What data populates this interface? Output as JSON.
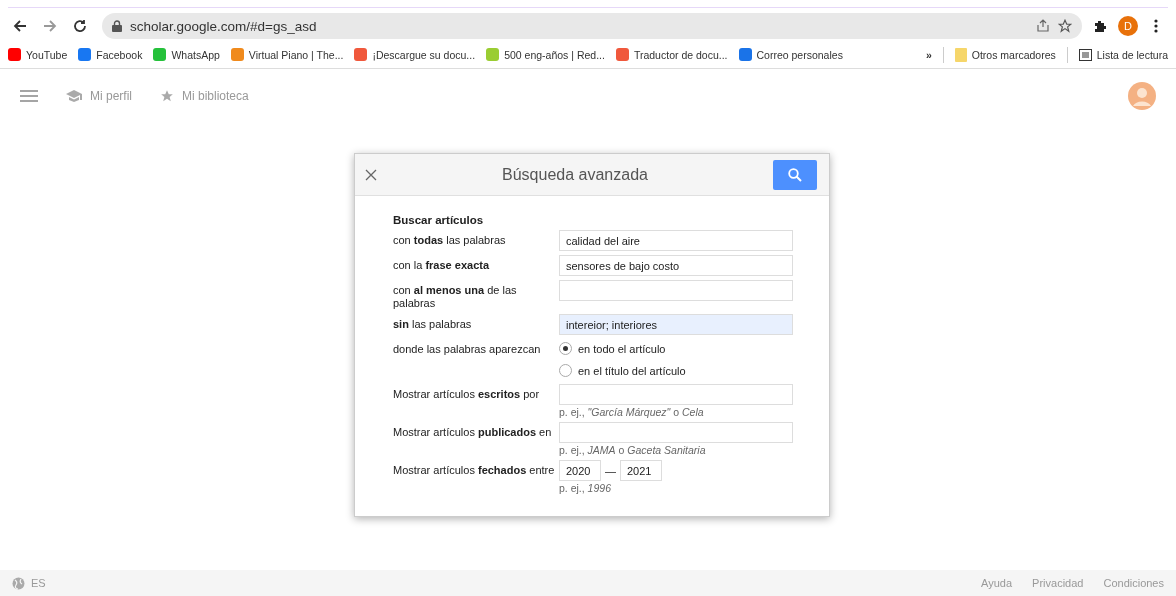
{
  "browser": {
    "url": "scholar.google.com/#d=gs_asd",
    "profile_initial": "D",
    "bookmarks": [
      {
        "label": "YouTube",
        "color": "#ff0000"
      },
      {
        "label": "Facebook",
        "color": "#1877f2"
      },
      {
        "label": "WhatsApp",
        "color": "#25c13b"
      },
      {
        "label": "Virtual Piano | The...",
        "color": "#f08a1c"
      },
      {
        "label": "¡Descargue su docu...",
        "color": "#f0583c"
      },
      {
        "label": "500 eng-años | Red...",
        "color": "#9acd32"
      },
      {
        "label": "Traductor de docu...",
        "color": "#f0583c"
      },
      {
        "label": "Correo personales",
        "color": "#1a73e8"
      }
    ],
    "more": "»",
    "other_bookmarks": "Otros marcadores",
    "reading_list": "Lista de lectura"
  },
  "header": {
    "nav": [
      {
        "label": "Mi perfil",
        "kind": "profile"
      },
      {
        "label": "Mi biblioteca",
        "kind": "library"
      }
    ]
  },
  "dialog": {
    "title": "Búsqueda avanzada",
    "section": "Buscar artículos",
    "rows": [
      {
        "kind": "text",
        "label": "con **todas** las palabras",
        "value": "calidad del aire",
        "focused": false
      },
      {
        "kind": "text",
        "label": "con la **frase exacta**",
        "value": "sensores de bajo costo",
        "focused": false
      },
      {
        "kind": "text",
        "label": "con **al menos una** de las palabras",
        "focused": false
      },
      {
        "kind": "text",
        "label": "**sin** las palabras",
        "value": "intereior; interiores",
        "focused": true
      },
      {
        "kind": "radio",
        "label": "donde las palabras aparezcan",
        "options": [
          {
            "label": "en todo el artículo",
            "selected": true
          },
          {
            "label": "en el título del artículo",
            "selected": false
          }
        ]
      },
      {
        "kind": "text",
        "label": "Mostrar artículos **escritos** por",
        "hint": "p. ej., *\"García Márquez\"* o *Cela*",
        "focused": false
      },
      {
        "kind": "text",
        "label": "Mostrar artículos **publicados** en",
        "hint": "p. ej., *JAMA* o *Gaceta Sanitaria*",
        "focused": false
      },
      {
        "kind": "dates",
        "label": "Mostrar artículos **fechados** entre",
        "from": "2020",
        "separator": "—",
        "to": "2021",
        "hint": "p. ej., *1996*"
      }
    ]
  },
  "footer": {
    "language": "ES",
    "links": [
      "Ayuda",
      "Privacidad",
      "Condiciones"
    ]
  }
}
